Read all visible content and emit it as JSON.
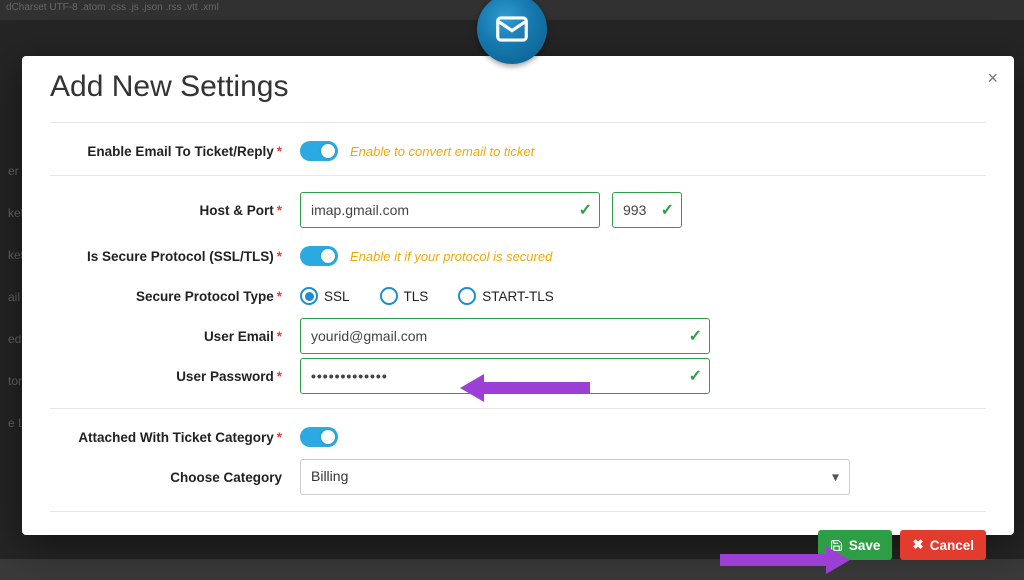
{
  "bg": {
    "topbar": "dCharset UTF-8 .atom .css .js .json .rss .vtt .xml",
    "sidebar": [
      "er F",
      "ket",
      "ket",
      "ail F",
      "ed",
      "tor",
      "e Licenser Setting"
    ]
  },
  "modal": {
    "title": "Add New Settings",
    "close": "×"
  },
  "labels": {
    "enable_email": "Enable Email To Ticket/Reply",
    "host_port": "Host & Port",
    "secure_protocol": "Is Secure Protocol (SSL/TLS)",
    "protocol_type": "Secure Protocol Type",
    "user_email": "User Email",
    "user_password": "User Password",
    "attached_category": "Attached With Ticket Category",
    "choose_category": "Choose Category"
  },
  "hints": {
    "enable_email": "Enable to convert email to ticket",
    "secure_protocol": "Enable it if your protocol is secured"
  },
  "fields": {
    "host": "imap.gmail.com",
    "port": "993",
    "user_email": "yourid@gmail.com",
    "user_password": "•••••••••••••",
    "category": "Billing"
  },
  "radios": {
    "ssl": "SSL",
    "tls": "TLS",
    "starttls": "START-TLS"
  },
  "buttons": {
    "save": "Save",
    "cancel": "Cancel"
  }
}
